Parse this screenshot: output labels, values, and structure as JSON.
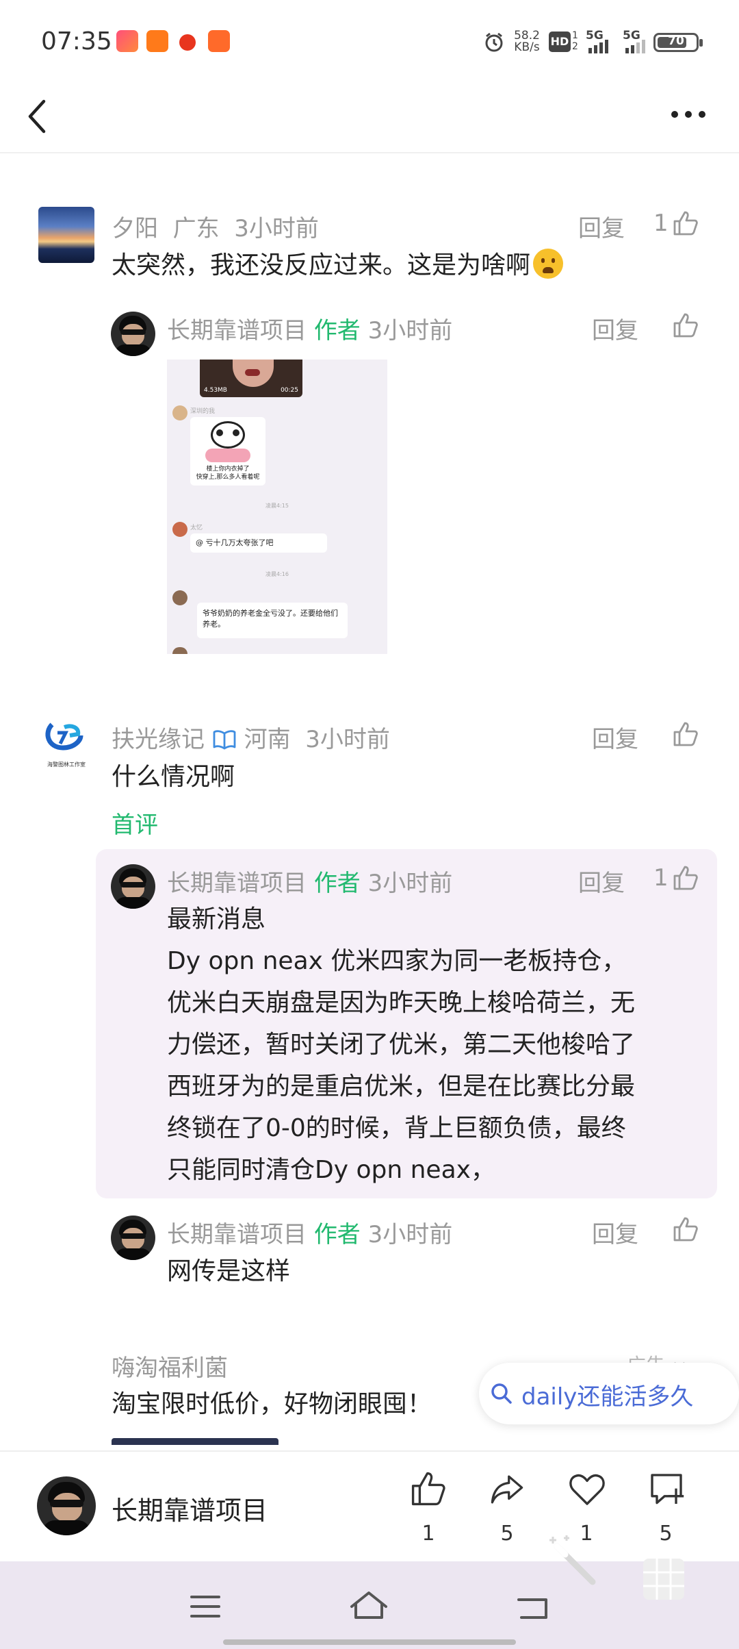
{
  "status": {
    "time": "07:35",
    "net_speed_value": "58.2",
    "net_speed_unit": "KB/s",
    "hd": "HD",
    "sim1": "1",
    "sim2": "2",
    "net1": "5G",
    "net2": "5G",
    "battery": "70"
  },
  "comments": [
    {
      "username": "夕阳",
      "location": "广东",
      "time": "3小时前",
      "text": "太突然，我还没反应过来。这是为啥啊",
      "reply_label": "回复",
      "likes": "1",
      "reply": {
        "username": "长期靠谱项目",
        "author_tag": "作者",
        "time": "3小时前",
        "reply_label": "回复",
        "image": {
          "video_size": "4.53MB",
          "video_duration": "00:25",
          "msg1_name": "深圳的我",
          "sticker_caption_1": "楼上你内衣掉了",
          "sticker_caption_2": "快穿上,那么多人看着呢",
          "time1": "凌晨4:15",
          "msg2_name": "太忆",
          "msg2_text": "@ 亏十几万太夸张了吧",
          "time2": "凌晨4:16",
          "msg3_text": "爷爷奶奶的养老金全亏没了。还要给他们养老。"
        }
      }
    },
    {
      "username": "扶光缘记",
      "location": "河南",
      "time": "3小时前",
      "text": "什么情况啊",
      "first_label": "首评",
      "reply_label": "回复",
      "logo_text": "海警图林工作室",
      "replies": [
        {
          "username": "长期靠谱项目",
          "author_tag": "作者",
          "time": "3小时前",
          "reply_label": "回复",
          "likes": "1",
          "lines": [
            "最新消息",
            "Dy opn  neax  优米四家为同一老板持仓，",
            "优米白天崩盘是因为昨天晚上梭哈荷兰，无",
            "力偿还，暂时关闭了优米，第二天他梭哈了",
            "西班牙为的是重启优米，但是在比赛比分最",
            "终锁在了0-0的时候，背上巨额负债，最终",
            "只能同时清仓Dy  opn  neax，"
          ]
        },
        {
          "username": "长期靠谱项目",
          "author_tag": "作者",
          "time": "3小时前",
          "reply_label": "回复",
          "text": "网传是这样"
        }
      ]
    }
  ],
  "ad": {
    "advertiser": "嗨淘福利菌",
    "tag": "广告",
    "text": "淘宝限时低价，好物闭眼囤！"
  },
  "search_suggestion": "daily还能活多久",
  "bottom_bar": {
    "author_name": "长期靠谱项目",
    "like_count": "1",
    "share_count": "5",
    "favorite_count": "1",
    "comment_count": "5"
  },
  "colors": {
    "accent_green": "#22b96f",
    "search_blue": "#4a6bd6",
    "highlight_bg": "#f6f0f8"
  }
}
